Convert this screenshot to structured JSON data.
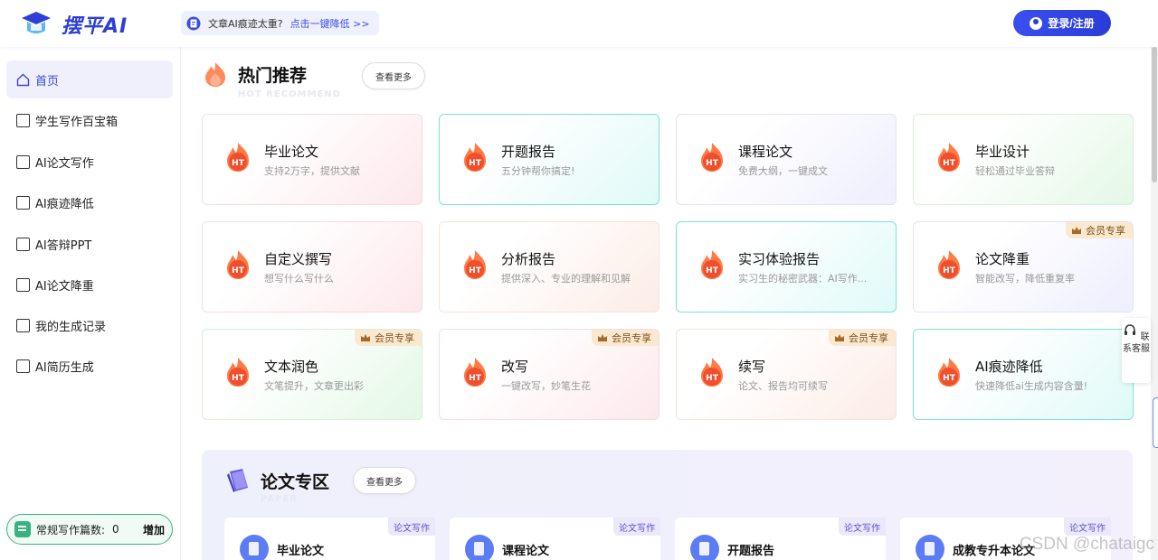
{
  "header": {
    "logo_text": "摆平AI",
    "promo_text": "文章AI痕迹太重?",
    "promo_link": "点击一键降低 >>",
    "login_label": "登录/注册"
  },
  "sidebar": {
    "items": [
      {
        "label": "首页",
        "icon": "home-icon"
      },
      {
        "label": "学生写作百宝箱",
        "icon": "ai-doc-icon"
      },
      {
        "label": "AI论文写作",
        "icon": "ai-doc-icon"
      },
      {
        "label": "AI痕迹降低",
        "icon": "doc-icon"
      },
      {
        "label": "AI答辩PPT",
        "icon": "doc-icon"
      },
      {
        "label": "AI论文降重",
        "icon": "doc-icon"
      },
      {
        "label": "我的生成记录",
        "icon": "record-icon"
      },
      {
        "label": "AI简历生成",
        "icon": "resume-icon"
      }
    ],
    "quota_label": "常规写作篇数:",
    "quota_count": "0",
    "quota_add": "增加"
  },
  "hot": {
    "title": "热门推荐",
    "subtitle": "HOT RECOMMEND",
    "more": "查看更多",
    "vip_label": "会员专享",
    "cards": [
      {
        "title": "毕业论文",
        "desc": "支持2万字，提供文献",
        "vip": false,
        "color": "pink"
      },
      {
        "title": "开题报告",
        "desc": "五分钟帮你搞定!",
        "vip": false,
        "color": "cyan"
      },
      {
        "title": "课程论文",
        "desc": "免费大纲，一键成文",
        "vip": false,
        "color": "lav"
      },
      {
        "title": "毕业设计",
        "desc": "轻松通过毕业答辩",
        "vip": false,
        "color": "green"
      },
      {
        "title": "自定义撰写",
        "desc": "想写什么写什么",
        "vip": false,
        "color": "pink"
      },
      {
        "title": "分析报告",
        "desc": "提供深入、专业的理解和见解",
        "vip": false,
        "color": "peach"
      },
      {
        "title": "实习体验报告",
        "desc": "实习生的秘密武器：AI写作...",
        "vip": false,
        "color": "cyan"
      },
      {
        "title": "论文降重",
        "desc": "智能改写，降低重复率",
        "vip": true,
        "color": "lav"
      },
      {
        "title": "文本润色",
        "desc": "文笔提升，文章更出彩",
        "vip": true,
        "color": "green"
      },
      {
        "title": "改写",
        "desc": "一键改写，妙笔生花",
        "vip": true,
        "color": "pink"
      },
      {
        "title": "续写",
        "desc": "论文、报告均可续写",
        "vip": true,
        "color": "peach"
      },
      {
        "title": "AI痕迹降低",
        "desc": "快速降低ai生成内容含量!",
        "vip": false,
        "color": "cyan"
      }
    ]
  },
  "paper": {
    "title": "论文专区",
    "subtitle": "PAPER",
    "more": "查看更多",
    "tag": "论文写作",
    "cards": [
      {
        "title": "毕业论文"
      },
      {
        "title": "课程论文"
      },
      {
        "title": "开题报告"
      },
      {
        "title": "成教专升本论文"
      }
    ]
  },
  "float": {
    "contact": "联系客服"
  },
  "watermark": "CSDN @chataigc"
}
